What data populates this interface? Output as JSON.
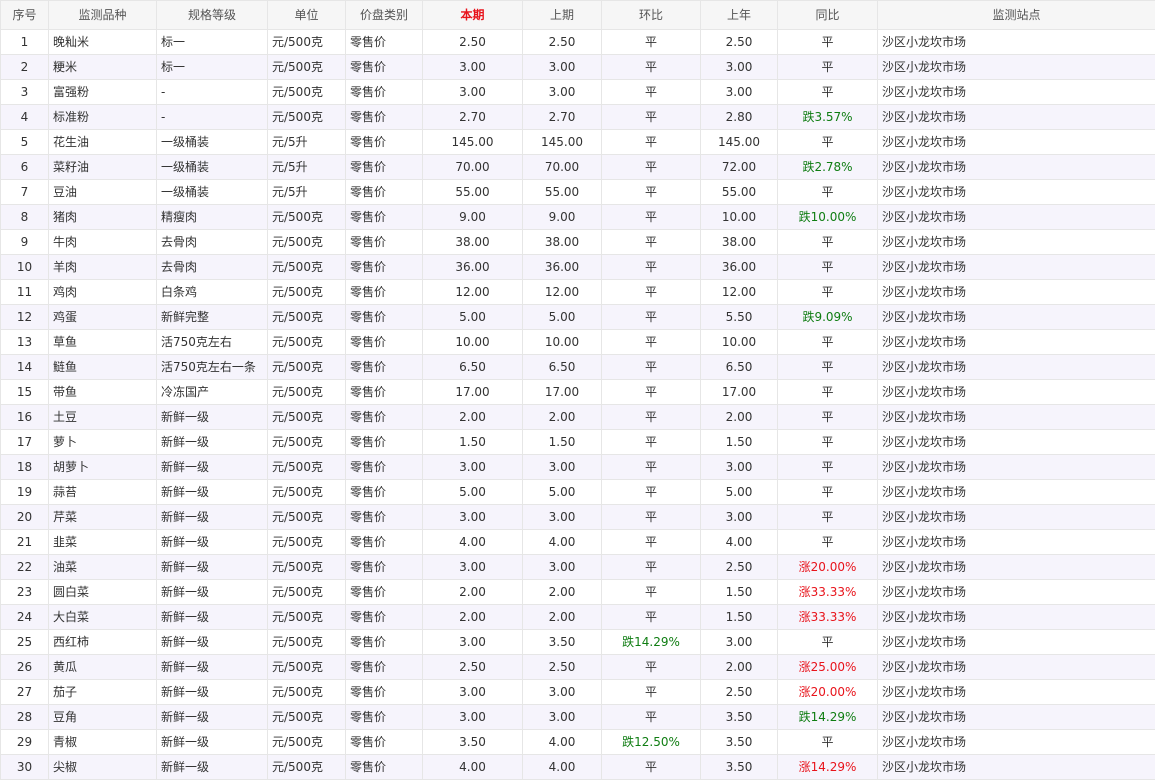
{
  "columns": [
    "序号",
    "监测品种",
    "规格等级",
    "单位",
    "价盘类别",
    "本期",
    "上期",
    "环比",
    "上年",
    "同比",
    "监测站点"
  ],
  "colors": {
    "current_header": "#e8131b",
    "rise": "#e8131b",
    "fall": "#0f7d12",
    "stripe": "#f6f4fc"
  },
  "rows": [
    {
      "no": "1",
      "item": "晚籼米",
      "spec": "标一",
      "unit": "元/500克",
      "price_type": "零售价",
      "current": "2.50",
      "previous": "2.50",
      "mom": "平",
      "last_year": "2.50",
      "yoy": "平",
      "station": "沙区小龙坎市场"
    },
    {
      "no": "2",
      "item": "粳米",
      "spec": "标一",
      "unit": "元/500克",
      "price_type": "零售价",
      "current": "3.00",
      "previous": "3.00",
      "mom": "平",
      "last_year": "3.00",
      "yoy": "平",
      "station": "沙区小龙坎市场"
    },
    {
      "no": "3",
      "item": "富强粉",
      "spec": "-",
      "unit": "元/500克",
      "price_type": "零售价",
      "current": "3.00",
      "previous": "3.00",
      "mom": "平",
      "last_year": "3.00",
      "yoy": "平",
      "station": "沙区小龙坎市场"
    },
    {
      "no": "4",
      "item": "标准粉",
      "spec": "-",
      "unit": "元/500克",
      "price_type": "零售价",
      "current": "2.70",
      "previous": "2.70",
      "mom": "平",
      "last_year": "2.80",
      "yoy": "跌3.57%",
      "station": "沙区小龙坎市场"
    },
    {
      "no": "5",
      "item": "花生油",
      "spec": "一级桶装",
      "unit": "元/5升",
      "price_type": "零售价",
      "current": "145.00",
      "previous": "145.00",
      "mom": "平",
      "last_year": "145.00",
      "yoy": "平",
      "station": "沙区小龙坎市场"
    },
    {
      "no": "6",
      "item": "菜籽油",
      "spec": "一级桶装",
      "unit": "元/5升",
      "price_type": "零售价",
      "current": "70.00",
      "previous": "70.00",
      "mom": "平",
      "last_year": "72.00",
      "yoy": "跌2.78%",
      "station": "沙区小龙坎市场"
    },
    {
      "no": "7",
      "item": "豆油",
      "spec": "一级桶装",
      "unit": "元/5升",
      "price_type": "零售价",
      "current": "55.00",
      "previous": "55.00",
      "mom": "平",
      "last_year": "55.00",
      "yoy": "平",
      "station": "沙区小龙坎市场"
    },
    {
      "no": "8",
      "item": "猪肉",
      "spec": "精瘦肉",
      "unit": "元/500克",
      "price_type": "零售价",
      "current": "9.00",
      "previous": "9.00",
      "mom": "平",
      "last_year": "10.00",
      "yoy": "跌10.00%",
      "station": "沙区小龙坎市场"
    },
    {
      "no": "9",
      "item": "牛肉",
      "spec": "去骨肉",
      "unit": "元/500克",
      "price_type": "零售价",
      "current": "38.00",
      "previous": "38.00",
      "mom": "平",
      "last_year": "38.00",
      "yoy": "平",
      "station": "沙区小龙坎市场"
    },
    {
      "no": "10",
      "item": "羊肉",
      "spec": "去骨肉",
      "unit": "元/500克",
      "price_type": "零售价",
      "current": "36.00",
      "previous": "36.00",
      "mom": "平",
      "last_year": "36.00",
      "yoy": "平",
      "station": "沙区小龙坎市场"
    },
    {
      "no": "11",
      "item": "鸡肉",
      "spec": "白条鸡",
      "unit": "元/500克",
      "price_type": "零售价",
      "current": "12.00",
      "previous": "12.00",
      "mom": "平",
      "last_year": "12.00",
      "yoy": "平",
      "station": "沙区小龙坎市场"
    },
    {
      "no": "12",
      "item": "鸡蛋",
      "spec": "新鲜完整",
      "unit": "元/500克",
      "price_type": "零售价",
      "current": "5.00",
      "previous": "5.00",
      "mom": "平",
      "last_year": "5.50",
      "yoy": "跌9.09%",
      "station": "沙区小龙坎市场"
    },
    {
      "no": "13",
      "item": "草鱼",
      "spec": "活750克左右",
      "unit": "元/500克",
      "price_type": "零售价",
      "current": "10.00",
      "previous": "10.00",
      "mom": "平",
      "last_year": "10.00",
      "yoy": "平",
      "station": "沙区小龙坎市场"
    },
    {
      "no": "14",
      "item": "鲢鱼",
      "spec": "活750克左右一条",
      "unit": "元/500克",
      "price_type": "零售价",
      "current": "6.50",
      "previous": "6.50",
      "mom": "平",
      "last_year": "6.50",
      "yoy": "平",
      "station": "沙区小龙坎市场"
    },
    {
      "no": "15",
      "item": "带鱼",
      "spec": "冷冻国产",
      "unit": "元/500克",
      "price_type": "零售价",
      "current": "17.00",
      "previous": "17.00",
      "mom": "平",
      "last_year": "17.00",
      "yoy": "平",
      "station": "沙区小龙坎市场"
    },
    {
      "no": "16",
      "item": "土豆",
      "spec": "新鲜一级",
      "unit": "元/500克",
      "price_type": "零售价",
      "current": "2.00",
      "previous": "2.00",
      "mom": "平",
      "last_year": "2.00",
      "yoy": "平",
      "station": "沙区小龙坎市场"
    },
    {
      "no": "17",
      "item": "萝卜",
      "spec": "新鲜一级",
      "unit": "元/500克",
      "price_type": "零售价",
      "current": "1.50",
      "previous": "1.50",
      "mom": "平",
      "last_year": "1.50",
      "yoy": "平",
      "station": "沙区小龙坎市场"
    },
    {
      "no": "18",
      "item": "胡萝卜",
      "spec": "新鲜一级",
      "unit": "元/500克",
      "price_type": "零售价",
      "current": "3.00",
      "previous": "3.00",
      "mom": "平",
      "last_year": "3.00",
      "yoy": "平",
      "station": "沙区小龙坎市场"
    },
    {
      "no": "19",
      "item": "蒜苔",
      "spec": "新鲜一级",
      "unit": "元/500克",
      "price_type": "零售价",
      "current": "5.00",
      "previous": "5.00",
      "mom": "平",
      "last_year": "5.00",
      "yoy": "平",
      "station": "沙区小龙坎市场"
    },
    {
      "no": "20",
      "item": "芹菜",
      "spec": "新鲜一级",
      "unit": "元/500克",
      "price_type": "零售价",
      "current": "3.00",
      "previous": "3.00",
      "mom": "平",
      "last_year": "3.00",
      "yoy": "平",
      "station": "沙区小龙坎市场"
    },
    {
      "no": "21",
      "item": "韭菜",
      "spec": "新鲜一级",
      "unit": "元/500克",
      "price_type": "零售价",
      "current": "4.00",
      "previous": "4.00",
      "mom": "平",
      "last_year": "4.00",
      "yoy": "平",
      "station": "沙区小龙坎市场"
    },
    {
      "no": "22",
      "item": "油菜",
      "spec": "新鲜一级",
      "unit": "元/500克",
      "price_type": "零售价",
      "current": "3.00",
      "previous": "3.00",
      "mom": "平",
      "last_year": "2.50",
      "yoy": "涨20.00%",
      "station": "沙区小龙坎市场"
    },
    {
      "no": "23",
      "item": "圆白菜",
      "spec": "新鲜一级",
      "unit": "元/500克",
      "price_type": "零售价",
      "current": "2.00",
      "previous": "2.00",
      "mom": "平",
      "last_year": "1.50",
      "yoy": "涨33.33%",
      "station": "沙区小龙坎市场"
    },
    {
      "no": "24",
      "item": "大白菜",
      "spec": "新鲜一级",
      "unit": "元/500克",
      "price_type": "零售价",
      "current": "2.00",
      "previous": "2.00",
      "mom": "平",
      "last_year": "1.50",
      "yoy": "涨33.33%",
      "station": "沙区小龙坎市场"
    },
    {
      "no": "25",
      "item": "西红柿",
      "spec": "新鲜一级",
      "unit": "元/500克",
      "price_type": "零售价",
      "current": "3.00",
      "previous": "3.50",
      "mom": "跌14.29%",
      "last_year": "3.00",
      "yoy": "平",
      "station": "沙区小龙坎市场"
    },
    {
      "no": "26",
      "item": "黄瓜",
      "spec": "新鲜一级",
      "unit": "元/500克",
      "price_type": "零售价",
      "current": "2.50",
      "previous": "2.50",
      "mom": "平",
      "last_year": "2.00",
      "yoy": "涨25.00%",
      "station": "沙区小龙坎市场"
    },
    {
      "no": "27",
      "item": "茄子",
      "spec": "新鲜一级",
      "unit": "元/500克",
      "price_type": "零售价",
      "current": "3.00",
      "previous": "3.00",
      "mom": "平",
      "last_year": "2.50",
      "yoy": "涨20.00%",
      "station": "沙区小龙坎市场"
    },
    {
      "no": "28",
      "item": "豆角",
      "spec": "新鲜一级",
      "unit": "元/500克",
      "price_type": "零售价",
      "current": "3.00",
      "previous": "3.00",
      "mom": "平",
      "last_year": "3.50",
      "yoy": "跌14.29%",
      "station": "沙区小龙坎市场"
    },
    {
      "no": "29",
      "item": "青椒",
      "spec": "新鲜一级",
      "unit": "元/500克",
      "price_type": "零售价",
      "current": "3.50",
      "previous": "4.00",
      "mom": "跌12.50%",
      "last_year": "3.50",
      "yoy": "平",
      "station": "沙区小龙坎市场"
    },
    {
      "no": "30",
      "item": "尖椒",
      "spec": "新鲜一级",
      "unit": "元/500克",
      "price_type": "零售价",
      "current": "4.00",
      "previous": "4.00",
      "mom": "平",
      "last_year": "3.50",
      "yoy": "涨14.29%",
      "station": "沙区小龙坎市场"
    }
  ]
}
